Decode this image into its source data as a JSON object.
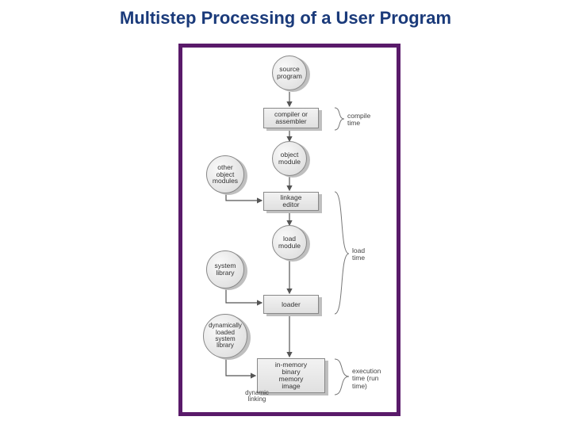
{
  "title": "Multistep Processing of a User Program",
  "nodes": {
    "source": {
      "label": "source\nprogram"
    },
    "compiler": {
      "label": "compiler or\nassembler"
    },
    "object": {
      "label": "object\nmodule"
    },
    "other": {
      "label": "other\nobject\nmodules"
    },
    "linker": {
      "label": "linkage\neditor"
    },
    "loadmod": {
      "label": "load\nmodule"
    },
    "syslib": {
      "label": "system\nlibrary"
    },
    "loader": {
      "label": "loader"
    },
    "dynlib": {
      "label": "dynamically\nloaded\nsystem\nlibrary"
    },
    "memimage": {
      "label": "in-memory\nbinary\nmemory\nimage"
    }
  },
  "phases": {
    "compile": "compile\ntime",
    "load": "load\ntime",
    "exec": "execution\ntime (run\ntime)"
  },
  "edgeLabels": {
    "dynlink": "dynamic\nlinking"
  }
}
